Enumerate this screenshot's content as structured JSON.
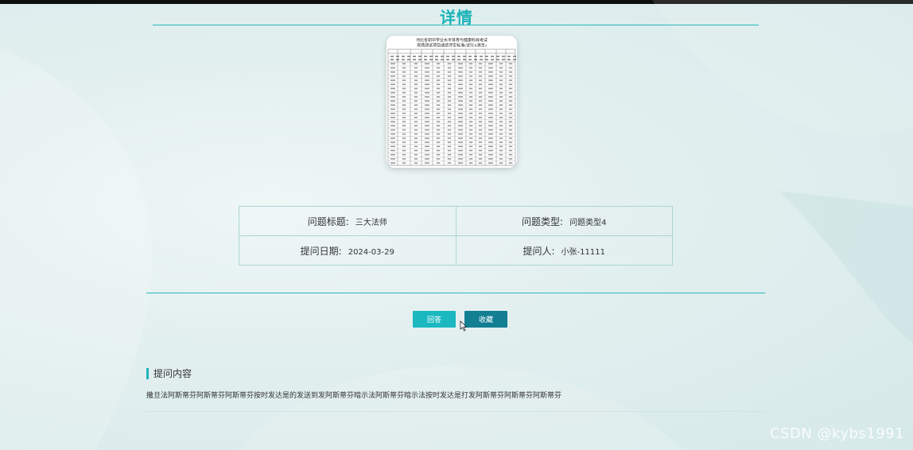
{
  "page": {
    "title": "详情"
  },
  "document_image": {
    "caption_line1": "河北省初中学业水平体育与健康科目考试",
    "caption_line2": "现场测试项目成绩评定标准(试行)(男生)"
  },
  "info": {
    "question_title_label": "问题标题:",
    "question_title_value": "三大法师",
    "question_type_label": "问题类型:",
    "question_type_value": "问题类型4",
    "question_date_label": "提问日期:",
    "question_date_value": "2024-03-29",
    "questioner_label": "提问人:",
    "questioner_value": "小张-11111"
  },
  "actions": {
    "answer_label": "回答",
    "favorite_label": "收藏"
  },
  "content": {
    "section_title": "提问内容",
    "text": "撒旦法阿斯蒂芬阿斯蒂芬阿斯蒂芬按时发达是的发送到发阿斯蒂芬暗示法阿斯蒂芬暗示法按时发达是打发阿斯蒂芬阿斯蒂芬阿斯蒂芬"
  },
  "watermark": "CSDN @kybs1991",
  "colors": {
    "accent": "#1ab3b8",
    "answer_button": "#1bb8c0",
    "favorite_button": "#127f93",
    "table_border": "#a9d7d4"
  }
}
